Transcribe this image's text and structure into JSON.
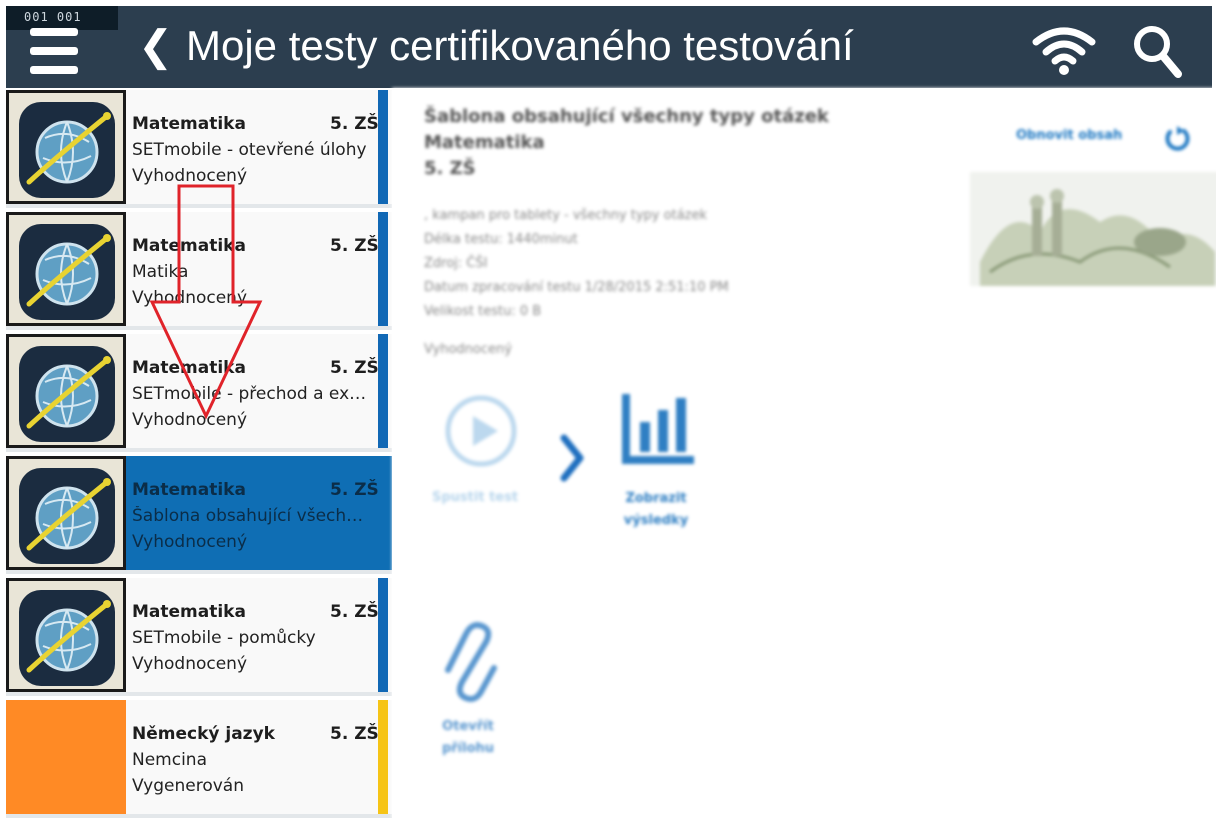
{
  "header": {
    "counter": "001  001",
    "back_symbol": "❮",
    "title": "Moje testy certifikovaného testování",
    "background": "#2c3e4f"
  },
  "list": [
    {
      "subject": "Matematika",
      "grade": "5. ZŠ",
      "name": "SETmobile - otevřené úlohy",
      "status": "Vyhodnocený",
      "selected": false,
      "accent": "#1168b5"
    },
    {
      "subject": "Matematika",
      "grade": "5. ZŠ",
      "name": "Matika",
      "status": "Vyhodnocený",
      "selected": false,
      "accent": "#1168b5"
    },
    {
      "subject": "Matematika",
      "grade": "5. ZŠ",
      "name": "SETmobile - přechod a expi...",
      "status": "Vyhodnocený",
      "selected": false,
      "accent": "#1168b5"
    },
    {
      "subject": "Matematika",
      "grade": "5. ZŠ",
      "name": "Šablona obsahující všechny...",
      "status": "Vyhodnocený",
      "selected": true,
      "accent": "#0f6eb4"
    },
    {
      "subject": "Matematika",
      "grade": "5. ZŠ",
      "name": "SETmobile - pomůcky",
      "status": "Vyhodnocený",
      "selected": false,
      "accent": "#1168b5"
    },
    {
      "subject": "Německý jazyk",
      "grade": "5. ZŠ",
      "name": "Nemcina",
      "status": "Vygenerován",
      "selected": false,
      "accent": "#f6c416"
    }
  ],
  "detail": {
    "title_line1": "Šablona obsahující všechny typy otázek",
    "title_line2": "Matematika",
    "title_line3": "5. ZŠ",
    "meta": [
      ", kampan pro tablety - všechny typy otázek",
      "Délka testu: 1440minut",
      "Zdroj: ČŠI",
      "Datum zpracování testu 1/28/2015 2:51:10 PM",
      "Velikost testu: 0 B"
    ],
    "status": "Vyhodnocený",
    "refresh_label": "Obnovit obsah",
    "start_label": "Spustit test",
    "results_label_line1": "Zobrazit",
    "results_label_line2": "výsledky",
    "attachment_label_line1": "Otevřít",
    "attachment_label_line2": "přílohu"
  },
  "colors": {
    "accent_blue": "#1168b5",
    "selected_bg": "#0f6eb4",
    "annotation_red": "#e0232a",
    "orange_tile": "#ff8a25"
  }
}
